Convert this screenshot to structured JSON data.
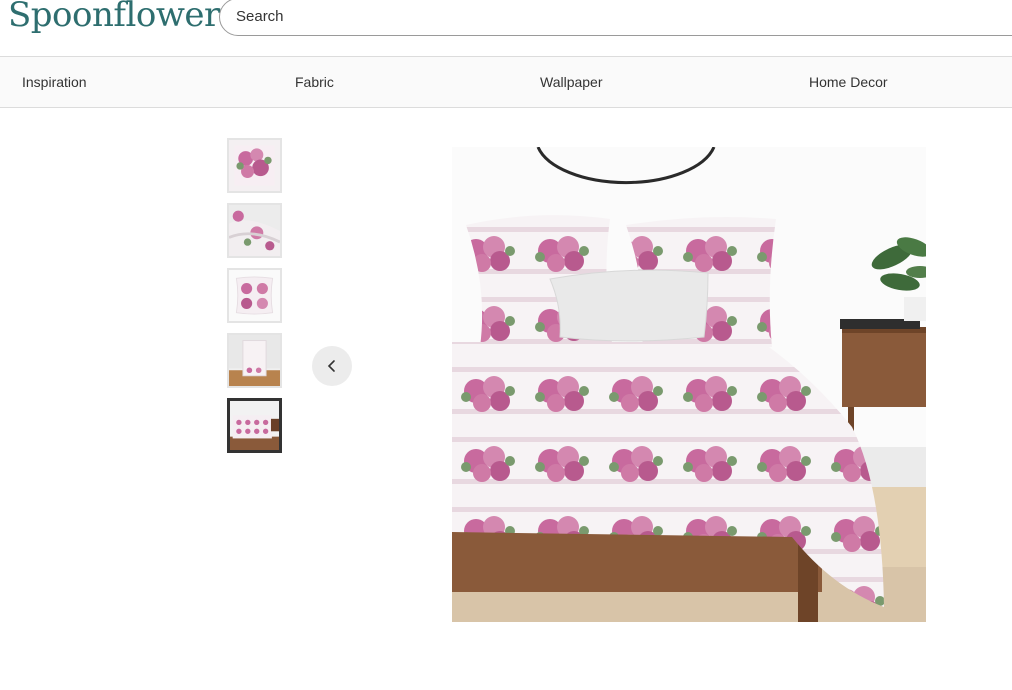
{
  "header": {
    "logo": "Spoonflower",
    "search_placeholder": "Search"
  },
  "nav": {
    "items": [
      "Inspiration",
      "Fabric",
      "Wallpaper",
      "Home Decor"
    ]
  },
  "gallery": {
    "thumbnails": [
      {
        "icon": "fabric-swatch-icon",
        "active": false
      },
      {
        "icon": "fabric-drape-icon",
        "active": false
      },
      {
        "icon": "pillow-icon",
        "active": false
      },
      {
        "icon": "tablecloth-icon",
        "active": false
      },
      {
        "icon": "duvet-bed-icon",
        "active": true
      }
    ],
    "prev_icon": "chevron-left-icon",
    "main_image_icon": "duvet-bed-scene-image"
  },
  "colors": {
    "brand": "#2e6e6f",
    "rose": "#c86a9e",
    "leaf": "#7a9a6e",
    "wood": "#8a5a3a"
  }
}
